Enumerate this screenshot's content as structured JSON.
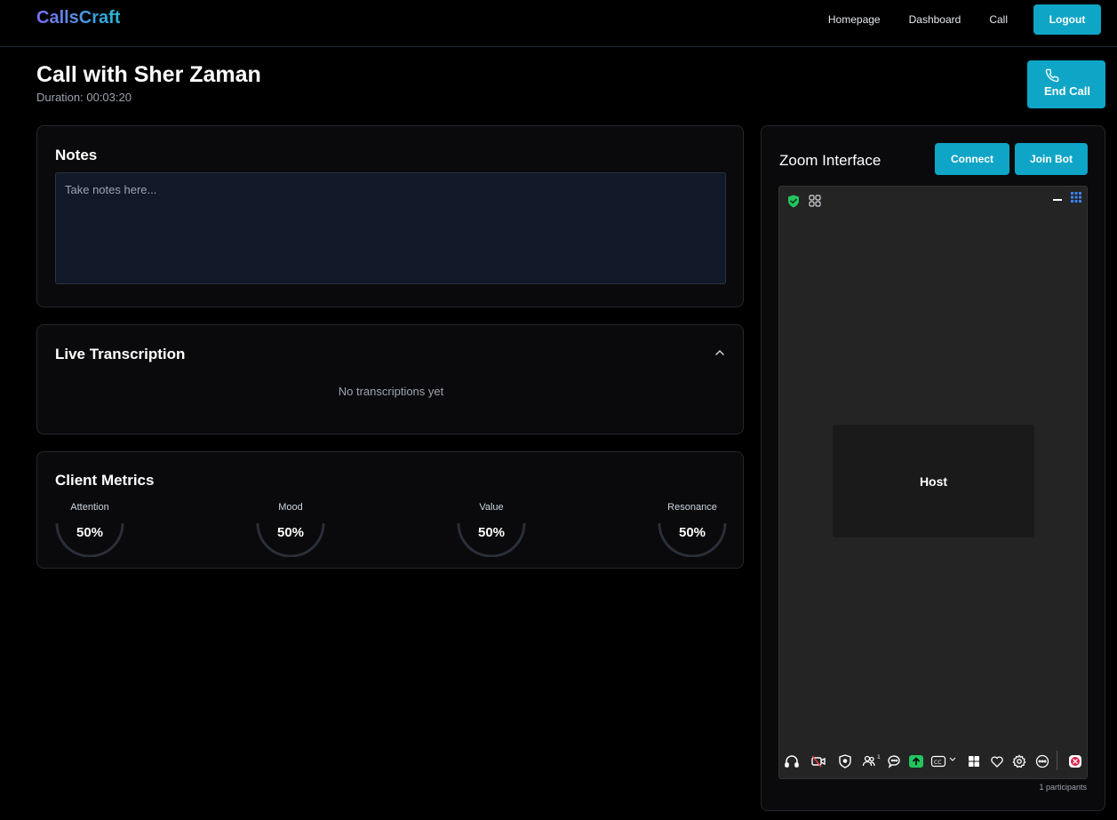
{
  "brand": "CallsCraft",
  "nav": {
    "homepage": "Homepage",
    "dashboard": "Dashboard",
    "call": "Call",
    "logout": "Logout"
  },
  "call": {
    "title": "Call with Sher Zaman",
    "duration": "Duration: 00:03:20",
    "end_call": "End Call"
  },
  "notes": {
    "title": "Notes",
    "placeholder": "Take notes here...",
    "value": ""
  },
  "transcription": {
    "title": "Live Transcription",
    "empty": "No transcriptions yet"
  },
  "metrics": {
    "title": "Client Metrics",
    "items": [
      {
        "label": "Attention",
        "value": "50%"
      },
      {
        "label": "Mood",
        "value": "50%"
      },
      {
        "label": "Value",
        "value": "50%"
      },
      {
        "label": "Resonance",
        "value": "50%"
      }
    ]
  },
  "zoom": {
    "title": "Zoom Interface",
    "connect": "Connect",
    "join_bot": "Join Bot",
    "host_label": "Host",
    "participant_badge": "1",
    "participants": "1 participants",
    "toolbar_icons": [
      "headphones-icon",
      "video-icon",
      "security-icon",
      "participants-icon",
      "chat-icon",
      "share-screen-icon",
      "captions-icon",
      "caret-down-icon",
      "gallery-icon",
      "reactions-icon",
      "settings-icon",
      "more-icon",
      "leave-icon"
    ]
  },
  "colors": {
    "accent": "#0ea5c6",
    "brand_start": "#7c6cf0",
    "brand_end": "#22b8d6",
    "secure_green": "#22c55e",
    "share_green": "#22c55e",
    "leave_red": "#e11d48"
  }
}
